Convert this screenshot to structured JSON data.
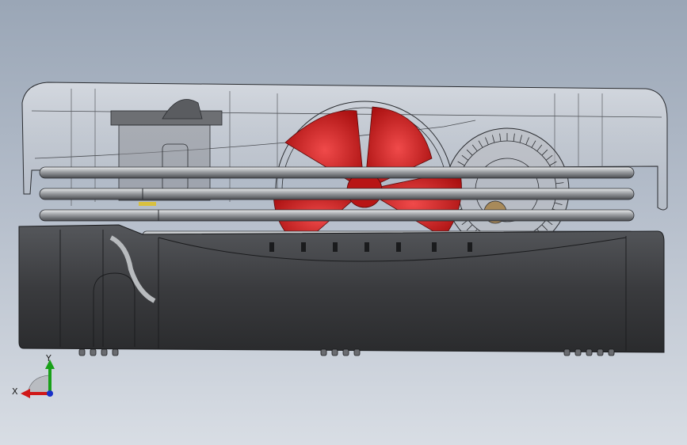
{
  "viewport": {
    "background_top": "#9aa6b6",
    "background_bottom": "#d8dde4"
  },
  "model": {
    "parts": [
      "transparent-top-cover",
      "red-fan-blades",
      "gear-wheel",
      "heat-pipes",
      "dark-base-housing",
      "bottom-feet"
    ],
    "colors": {
      "fan": "#c41818",
      "housing": "#3a3b3e",
      "pipes": "#8a8d91",
      "cover": "#c8ccd2"
    }
  },
  "triad": {
    "x_label": "X",
    "y_label": "Y",
    "x_color": "#d01818",
    "y_color": "#18a018",
    "z_color": "#1830c8"
  }
}
